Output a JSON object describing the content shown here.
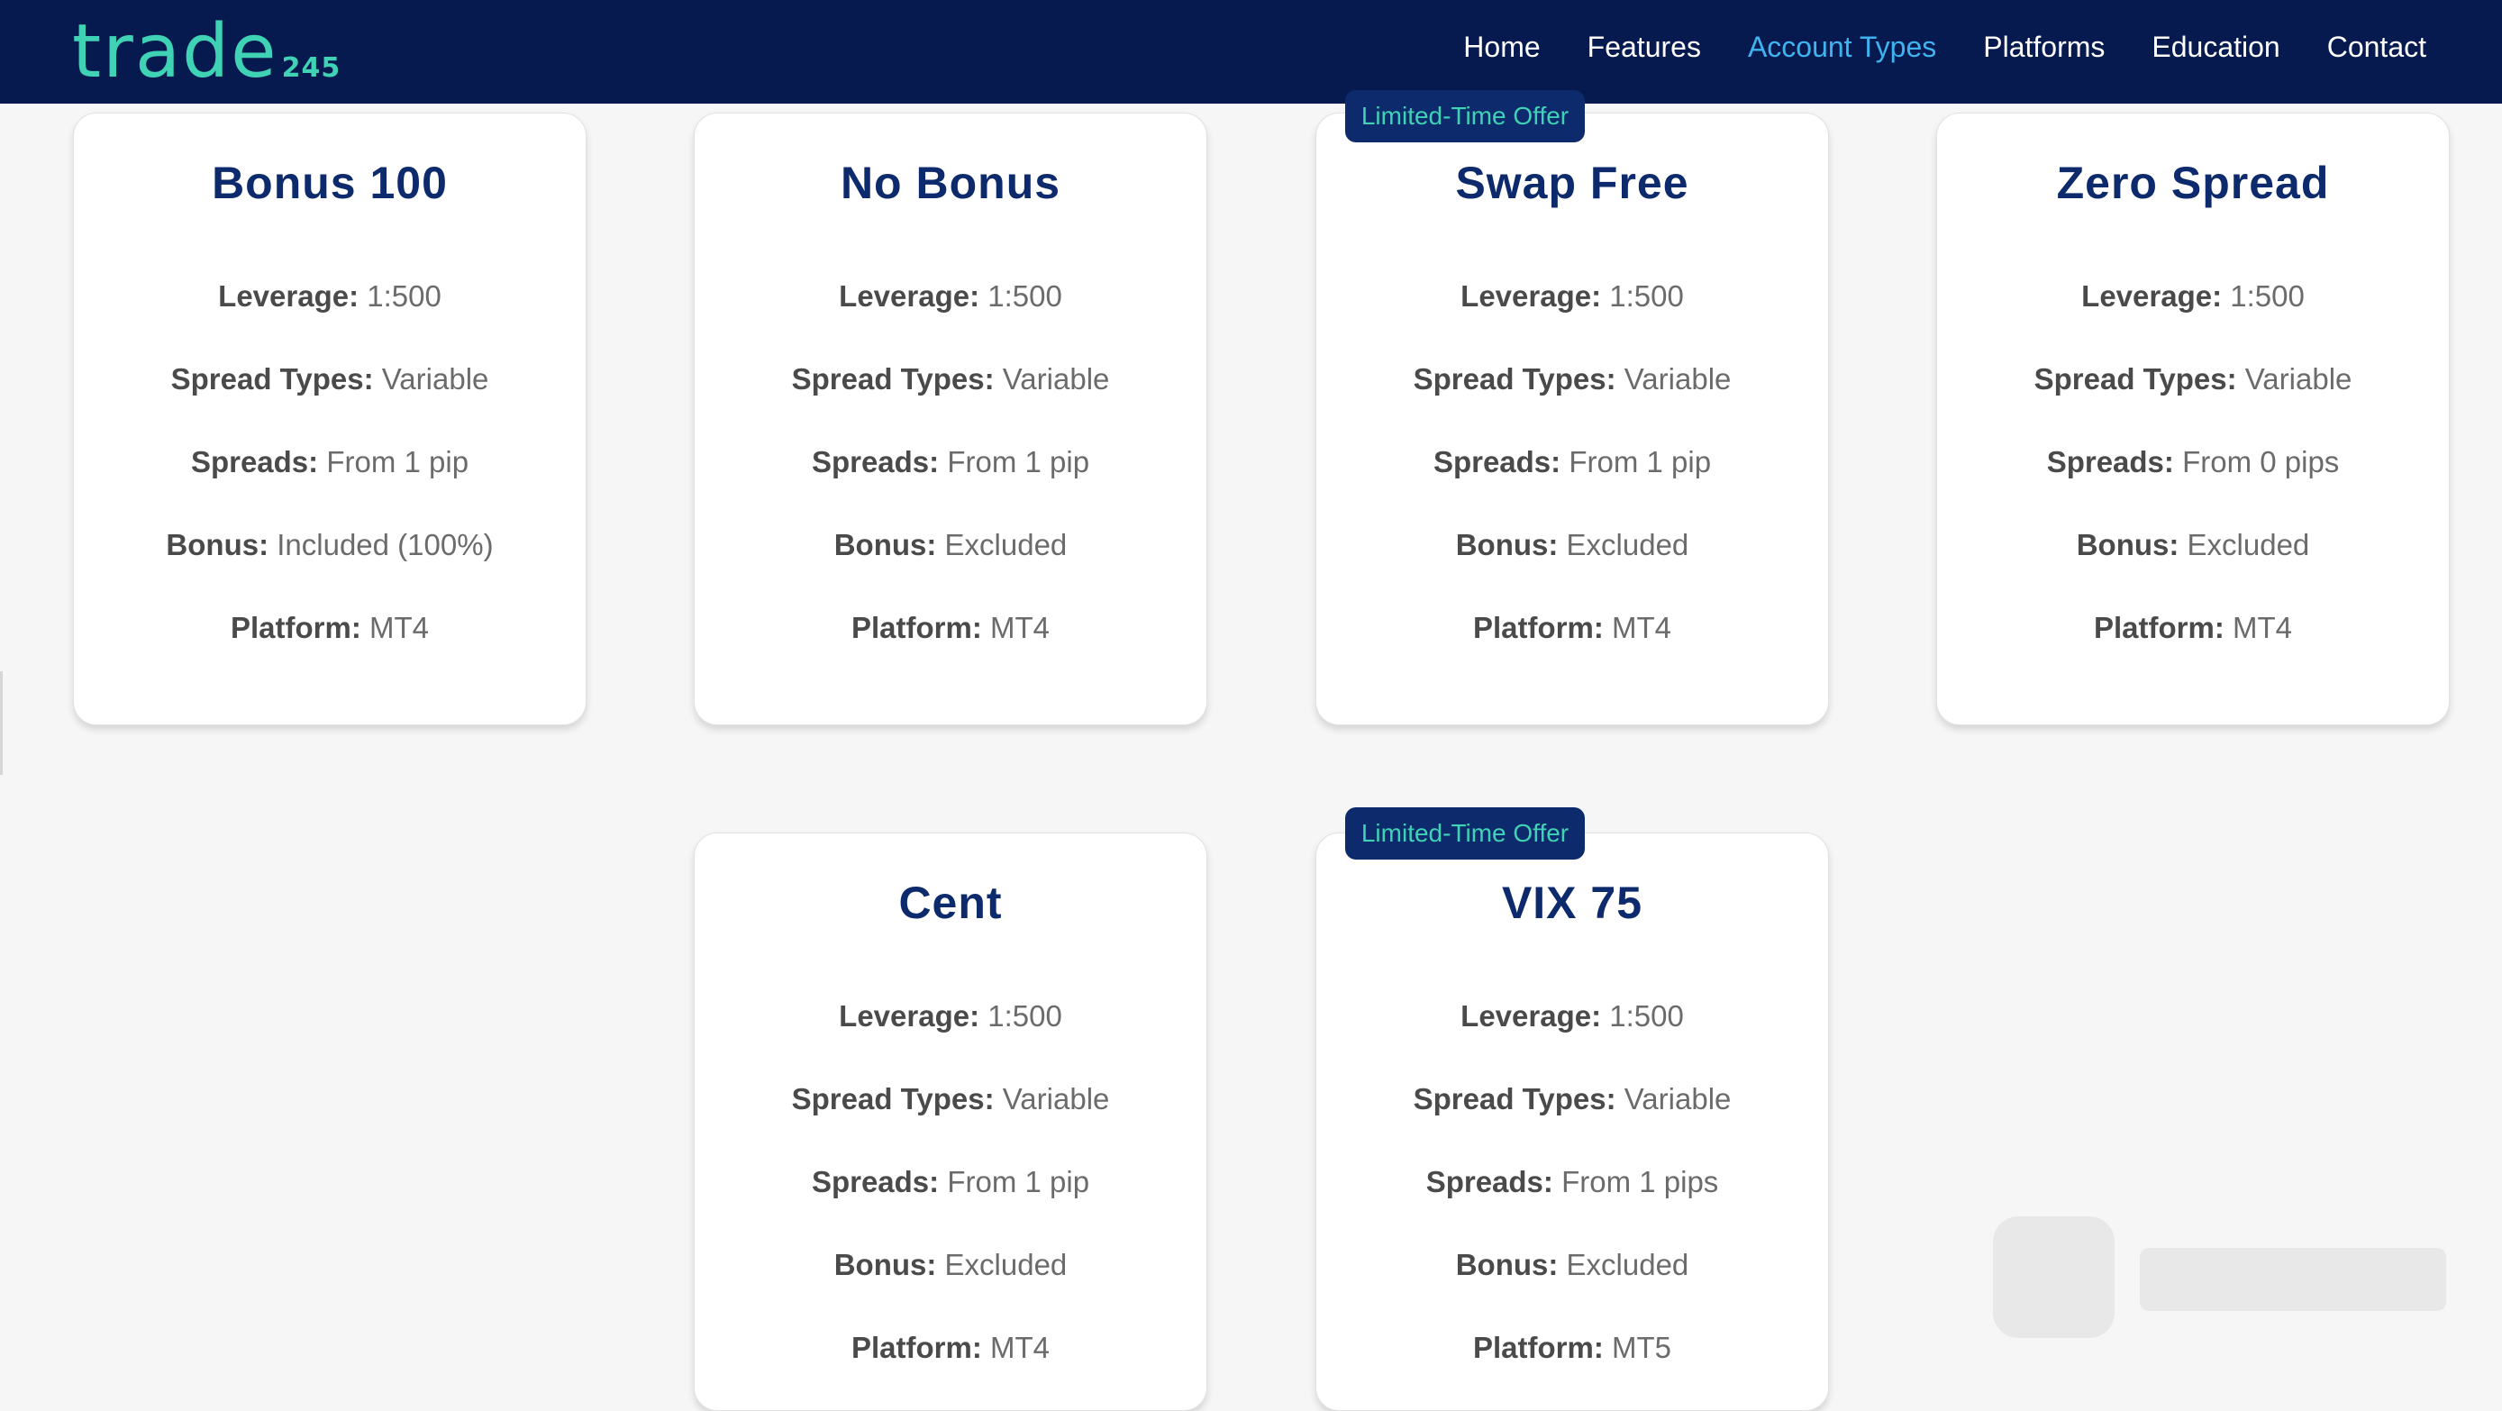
{
  "header": {
    "logo_word": "trade",
    "logo_number": "245",
    "nav": [
      {
        "label": "Home",
        "active": false
      },
      {
        "label": "Features",
        "active": false
      },
      {
        "label": "Account Types",
        "active": true
      },
      {
        "label": "Platforms",
        "active": false
      },
      {
        "label": "Education",
        "active": false
      },
      {
        "label": "Contact",
        "active": false
      }
    ]
  },
  "accounts": [
    {
      "title": "Bonus 100",
      "badge": "",
      "features": [
        {
          "label": "Leverage:",
          "value": "1:500"
        },
        {
          "label": "Spread Types:",
          "value": "Variable"
        },
        {
          "label": "Spreads:",
          "value": "From 1 pip"
        },
        {
          "label": "Bonus:",
          "value": "Included (100%)"
        },
        {
          "label": "Platform:",
          "value": "MT4"
        }
      ]
    },
    {
      "title": "No Bonus",
      "badge": "",
      "features": [
        {
          "label": "Leverage:",
          "value": "1:500"
        },
        {
          "label": "Spread Types:",
          "value": "Variable"
        },
        {
          "label": "Spreads:",
          "value": "From 1 pip"
        },
        {
          "label": "Bonus:",
          "value": "Excluded"
        },
        {
          "label": "Platform:",
          "value": "MT4"
        }
      ]
    },
    {
      "title": "Swap Free",
      "badge": "Limited-Time Offer",
      "features": [
        {
          "label": "Leverage:",
          "value": "1:500"
        },
        {
          "label": "Spread Types:",
          "value": "Variable"
        },
        {
          "label": "Spreads:",
          "value": "From 1 pip"
        },
        {
          "label": "Bonus:",
          "value": "Excluded"
        },
        {
          "label": "Platform:",
          "value": "MT4"
        }
      ]
    },
    {
      "title": "Zero Spread",
      "badge": "",
      "features": [
        {
          "label": "Leverage:",
          "value": "1:500"
        },
        {
          "label": "Spread Types:",
          "value": "Variable"
        },
        {
          "label": "Spreads:",
          "value": "From 0 pips"
        },
        {
          "label": "Bonus:",
          "value": "Excluded"
        },
        {
          "label": "Platform:",
          "value": "MT4"
        }
      ]
    },
    {
      "title": "Cent",
      "badge": "",
      "features": [
        {
          "label": "Leverage:",
          "value": "1:500"
        },
        {
          "label": "Spread Types:",
          "value": "Variable"
        },
        {
          "label": "Spreads:",
          "value": "From 1 pip"
        },
        {
          "label": "Bonus:",
          "value": "Excluded"
        },
        {
          "label": "Platform:",
          "value": "MT4"
        }
      ]
    },
    {
      "title": "VIX 75",
      "badge": "Limited-Time Offer",
      "features": [
        {
          "label": "Leverage:",
          "value": "1:500"
        },
        {
          "label": "Spread Types:",
          "value": "Variable"
        },
        {
          "label": "Spreads:",
          "value": "From 1 pips"
        },
        {
          "label": "Bonus:",
          "value": "Excluded"
        },
        {
          "label": "Platform:",
          "value": "MT5"
        }
      ]
    }
  ],
  "colors": {
    "header_bg": "#061a4f",
    "brand_teal": "#3fd2b4",
    "nav_active": "#3fb3f0",
    "card_title": "#0d2a6c",
    "badge_bg": "#0d2a6c"
  }
}
